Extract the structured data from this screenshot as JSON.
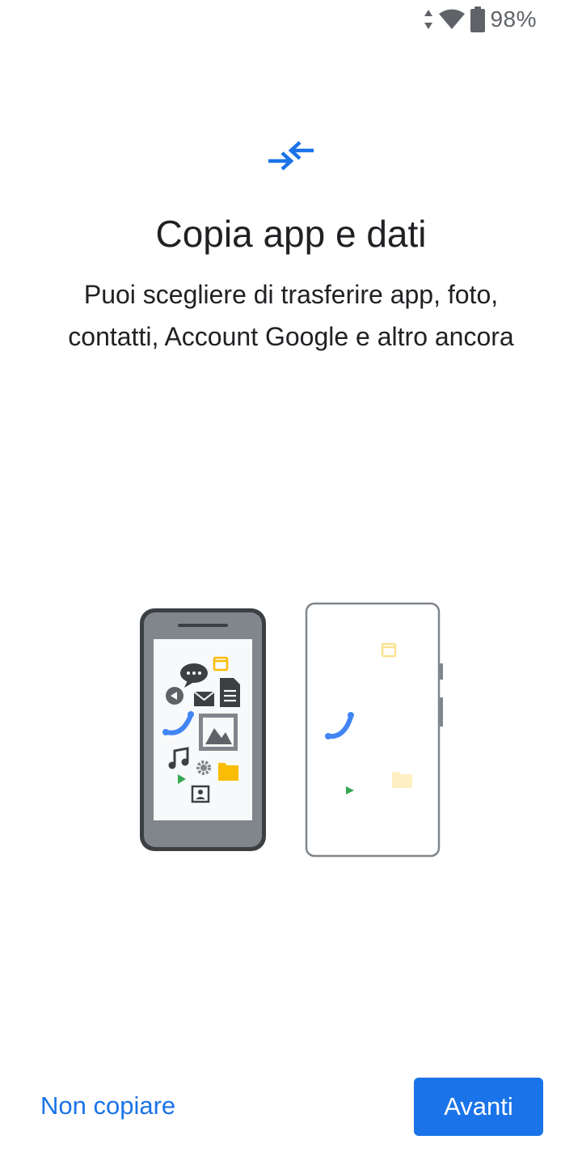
{
  "status_bar": {
    "battery_percent": "98%",
    "icons": [
      "data-transfer-icon",
      "wifi-icon",
      "battery-icon"
    ]
  },
  "header": {
    "icon": "swap-arrows-icon",
    "title": "Copia app e dati",
    "subtitle": "Puoi scegliere di trasferire app, foto, contatti, Account Google e altro ancora"
  },
  "illustration": {
    "source_phone_icons": [
      "message-icon",
      "calendar-icon",
      "document-icon",
      "back-icon",
      "mail-icon",
      "phone-icon",
      "image-icon",
      "music-icon",
      "settings-icon",
      "folder-icon",
      "play-icon",
      "contact-icon"
    ],
    "target_phone_icons": [
      "calendar-icon",
      "phone-icon",
      "play-icon",
      "folder-icon"
    ]
  },
  "footer": {
    "skip_label": "Non copiare",
    "next_label": "Avanti"
  },
  "colors": {
    "accent": "#1a73e8",
    "text": "#202124",
    "phone_dark": "#3c4043",
    "phone_gray": "#80868b",
    "yellow": "#fbbc04",
    "green": "#34a853",
    "icon_blue": "#4285f4"
  }
}
